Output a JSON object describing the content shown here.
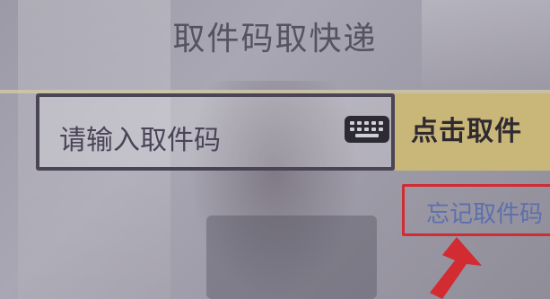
{
  "header": {
    "title": "取件码取快递"
  },
  "pickup_form": {
    "input_placeholder": "请输入取件码",
    "submit_label": "点击取件",
    "forgot_code_label": "忘记取件码"
  },
  "icons": {
    "keyboard": "keyboard-icon",
    "annotation_arrow": "arrow-icon"
  },
  "colors": {
    "title_text": "#565262",
    "input_border": "#4a4455",
    "button_bg": "#c9b77a",
    "annotation_red": "#d22b32",
    "link_text": "#5d6fae"
  }
}
